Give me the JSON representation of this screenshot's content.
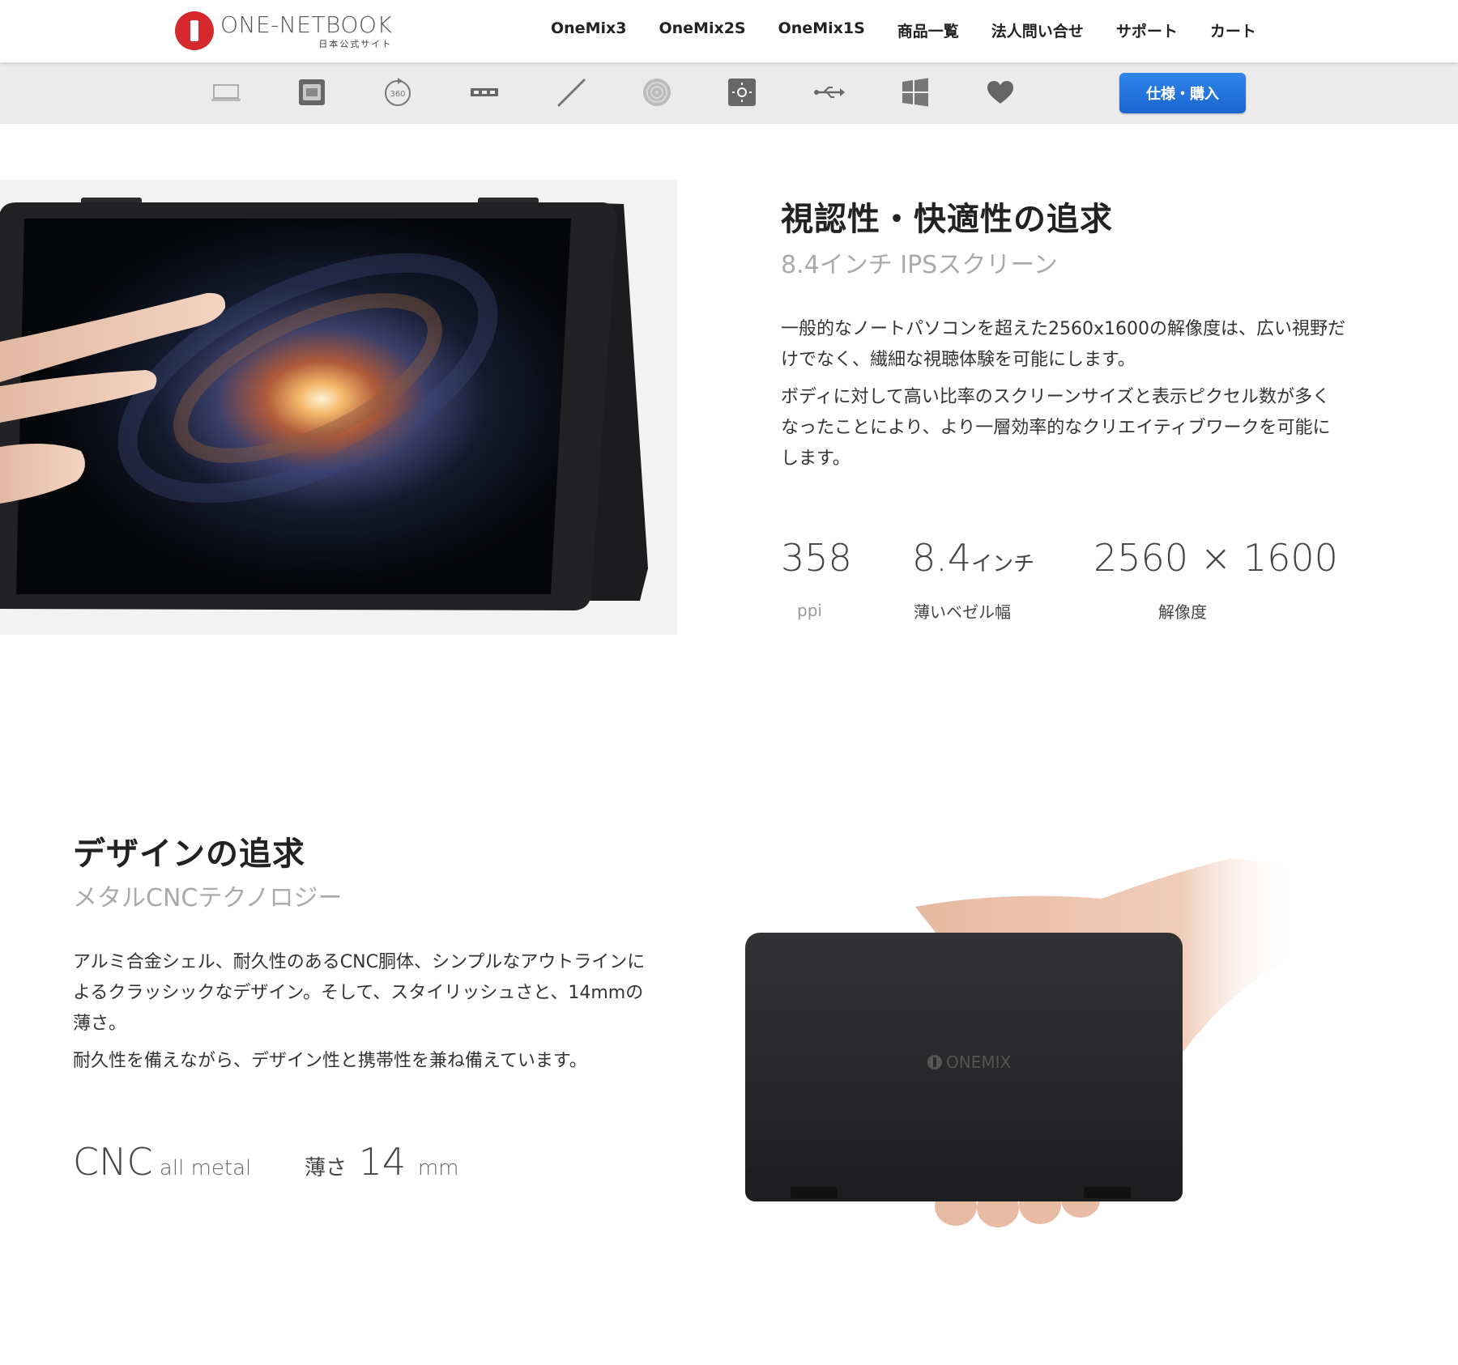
{
  "header": {
    "logo_name": "ONE-NETBOOK",
    "logo_sub": "日本公式サイト",
    "nav": [
      "OneMix3",
      "OneMix2S",
      "OneMix1S",
      "商品一覧",
      "法人問い合せ",
      "サポート",
      "カート"
    ]
  },
  "iconbar": {
    "icons": [
      "laptop-icon",
      "cpu-icon",
      "rotate-360-icon",
      "ram-icon",
      "pen-icon",
      "fingerprint-icon",
      "backlight-icon",
      "usb-icon",
      "windows-icon",
      "heart-icon"
    ],
    "rotate_label": "360",
    "buy_label": "仕様・購入"
  },
  "section1": {
    "title": "視認性・快適性の追求",
    "subtitle": "8.4インチ IPSスクリーン",
    "paragraphs": [
      "一般的なノートパソコンを超えた2560x1600の解像度は、広い視野だけでなく、繊細な視聴体験を可能にします。",
      "ボディに対して高い比率のスクリーンサイズと表示ピクセル数が多くなったことにより、より一層効率的なクリエイティブワークを可能にします。"
    ],
    "stats": [
      {
        "value": "358",
        "unit": "",
        "label": "ppi"
      },
      {
        "value": "8.4",
        "unit": "インチ",
        "label": "薄いベゼル幅"
      },
      {
        "value": "2560 × 1600",
        "unit": "",
        "label": "解像度"
      }
    ]
  },
  "section2": {
    "title": "デザインの追求",
    "subtitle": "メタルCNCテクノロジー",
    "paragraphs": [
      "アルミ合金シェル、耐久性のあるCNC胴体、シンプルなアウトラインによるクラッシックなデザイン。そして、スタイリッシュさと、14mmの薄さ。",
      "耐久性を備えながら、デザイン性と携帯性を兼ね備えています。"
    ],
    "stats": {
      "cnc_big": "CNC",
      "cnc_small": "all metal",
      "thin_prefix": "薄さ",
      "thin_value": "14",
      "thin_unit": "mm"
    },
    "device_logo": "ONEMIX"
  }
}
